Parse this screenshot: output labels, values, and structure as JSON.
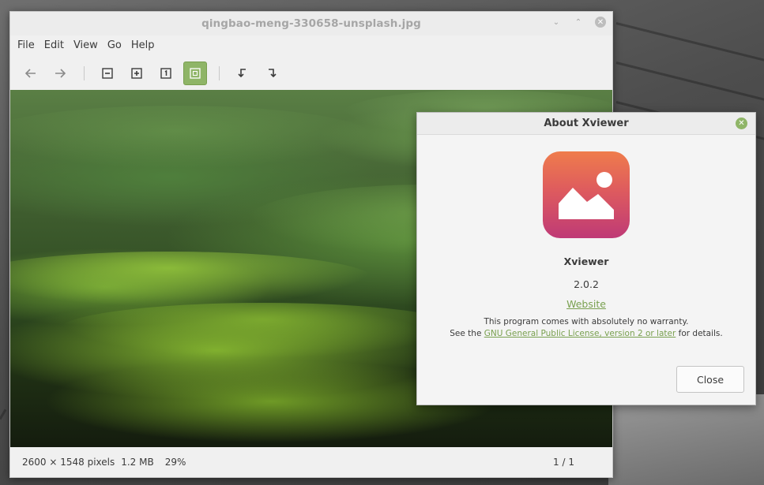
{
  "window": {
    "title": "qingbao-meng-330658-unsplash.jpg"
  },
  "menubar": {
    "items": [
      "File",
      "Edit",
      "View",
      "Go",
      "Help"
    ]
  },
  "toolbar": {
    "icons": [
      "back-arrow-icon",
      "forward-arrow-icon",
      "zoom-out-icon",
      "zoom-in-icon",
      "normal-size-icon",
      "best-fit-icon",
      "rotate-left-icon",
      "rotate-right-icon"
    ],
    "accent": "#8fb567"
  },
  "status": {
    "dimensions": "2600 × 1548 pixels",
    "size": "1.2 MB",
    "zoom": "29%",
    "page": "1 / 1"
  },
  "about": {
    "title": "About Xviewer",
    "app_name": "Xviewer",
    "version": "2.0.2",
    "website": "Website",
    "warranty": "This program comes with absolutely no warranty.",
    "license_prefix": "See the ",
    "license_link": "GNU General Public License, version 2 or later",
    "license_suffix": " for details.",
    "close": "Close",
    "link_color": "#79a04f"
  }
}
